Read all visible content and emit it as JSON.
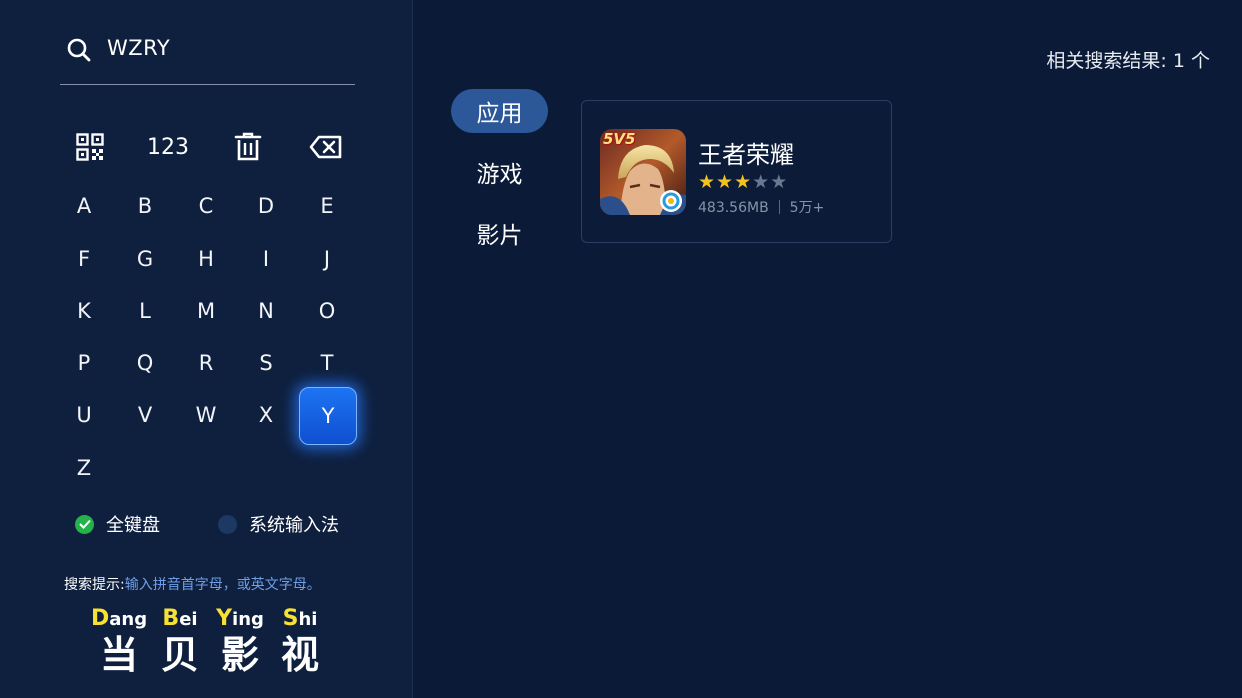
{
  "search": {
    "query": "WZRY"
  },
  "keyboard": {
    "tools": [
      {
        "name": "qrcode",
        "label": ""
      },
      {
        "name": "numbers",
        "label": "123"
      },
      {
        "name": "clear",
        "label": ""
      },
      {
        "name": "backspace",
        "label": ""
      }
    ],
    "keys": [
      "A",
      "B",
      "C",
      "D",
      "E",
      "F",
      "G",
      "H",
      "I",
      "J",
      "K",
      "L",
      "M",
      "N",
      "O",
      "P",
      "Q",
      "R",
      "S",
      "T",
      "U",
      "V",
      "W",
      "X",
      "Y",
      "Z"
    ],
    "selected_key": "Y"
  },
  "input_modes": {
    "full_keyboard": "全键盘",
    "system_ime": "系统输入法",
    "selected": "full_keyboard"
  },
  "hint": {
    "label": "搜索提示:",
    "text": "输入拼音首字母，或英文字母。"
  },
  "brand": [
    {
      "initial": "D",
      "rest": "ang",
      "hanzi": "当"
    },
    {
      "initial": "B",
      "rest": "ei",
      "hanzi": "贝"
    },
    {
      "initial": "Y",
      "rest": "ing",
      "hanzi": "影"
    },
    {
      "initial": "S",
      "rest": "hi",
      "hanzi": "视"
    }
  ],
  "results": {
    "count_text": "相关搜索结果: 1 个"
  },
  "tabs": [
    {
      "label": "应用",
      "active": true
    },
    {
      "label": "游戏",
      "active": false
    },
    {
      "label": "影片",
      "active": false
    }
  ],
  "apps": [
    {
      "name": "王者荣耀",
      "rating": 3,
      "rating_max": 5,
      "size": "483.56MB",
      "downloads": "5万+",
      "icon_badge": "5V5"
    }
  ],
  "colors": {
    "background": "#0b1a36",
    "panel": "#0f203f",
    "accent": "#1d74f2",
    "tab_active": "#2c5798",
    "star": "#f5c21b",
    "brand_initial": "#f7e233",
    "check": "#26b24a",
    "hint_text": "#6f9ee8"
  }
}
